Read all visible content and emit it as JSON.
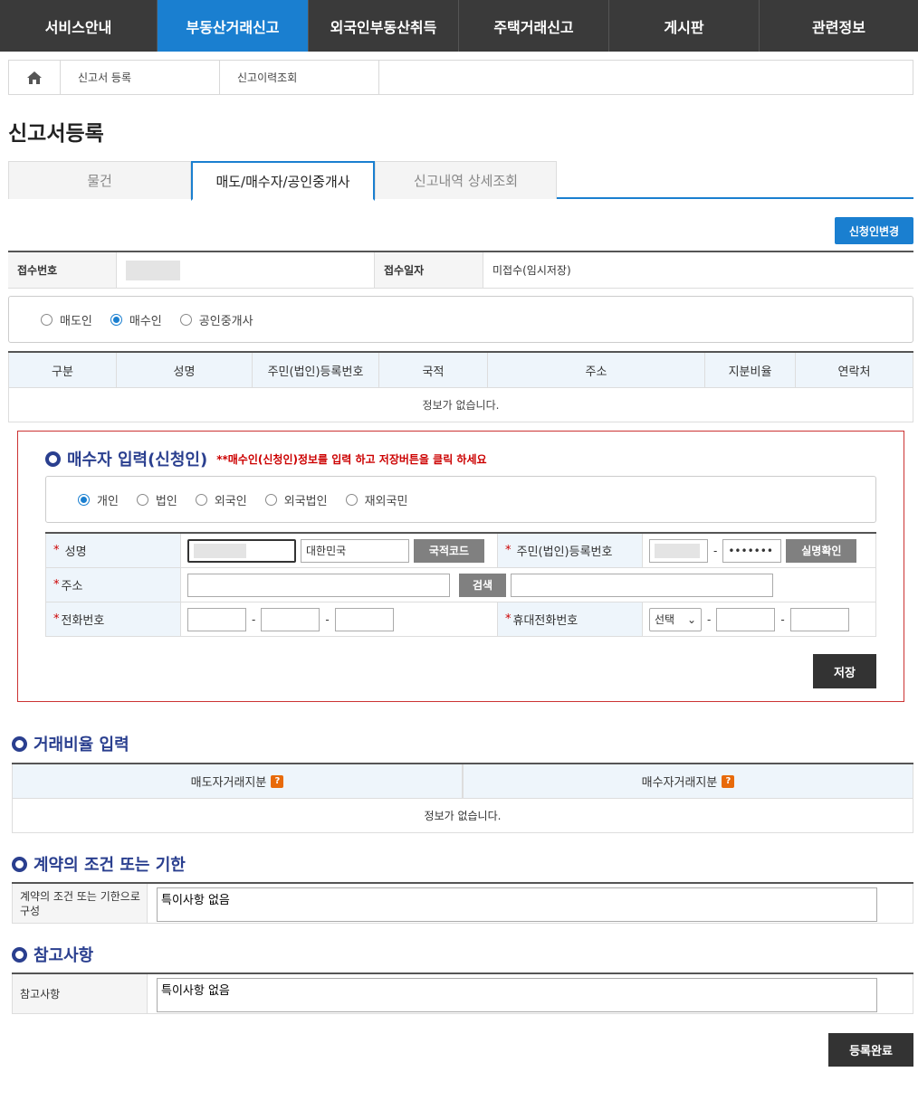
{
  "nav": {
    "items": [
      {
        "label": "서비스안내",
        "active": false
      },
      {
        "label": "부동산거래신고",
        "active": true
      },
      {
        "label": "외국인부동산취득",
        "active": false
      },
      {
        "label": "주택거래신고",
        "active": false
      },
      {
        "label": "게시판",
        "active": false
      },
      {
        "label": "관련정보",
        "active": false
      }
    ]
  },
  "breadcrumb": {
    "home_icon": "home-icon",
    "items": [
      "신고서 등록",
      "신고이력조회"
    ]
  },
  "page_title": "신고서등록",
  "tabs": [
    {
      "label": "물건",
      "active": false
    },
    {
      "label": "매도/매수자/공인중개사",
      "active": true
    },
    {
      "label": "신고내역 상세조회",
      "active": false
    }
  ],
  "change_applicant_label": "신청인변경",
  "receipt": {
    "number_label": "접수번호",
    "number_value": "",
    "date_label": "접수일자",
    "date_value": "미접수(임시저장)"
  },
  "roles": {
    "options": [
      "매도인",
      "매수인",
      "공인중개사"
    ],
    "selected": "매수인"
  },
  "party_table": {
    "headers": [
      "구분",
      "성명",
      "주민(법인)등록번호",
      "국적",
      "주소",
      "지분비율",
      "연락처"
    ],
    "empty_text": "정보가 없습니다."
  },
  "buyer": {
    "title": "매수자 입력(신청인)",
    "hint": "**매수인(신청인)정보를 입력 하고 저장버튼을 클릭 하세요",
    "person_types": [
      "개인",
      "법인",
      "외국인",
      "외국법인",
      "재외국민"
    ],
    "person_selected": "개인",
    "fields": {
      "name_label": "성명",
      "nationality_value": "대한민국",
      "nationality_btn": "국적코드",
      "rrn_label": "주민(법인)등록번호",
      "rrn_back": "•••••••",
      "verify_btn": "실명확인",
      "address_label": "주소",
      "search_btn": "검색",
      "phone_label": "전화번호",
      "mobile_label": "휴대전화번호",
      "mobile_select": "선택",
      "dash": "-"
    },
    "save_label": "저장"
  },
  "ratio": {
    "title": "거래비율 입력",
    "seller_header": "매도자거래지분",
    "buyer_header": "매수자거래지분",
    "help_icon": "?",
    "empty_text": "정보가 없습니다."
  },
  "terms": {
    "title": "계약의 조건 또는 기한",
    "label": "계약의 조건 또는 기한으로 구성",
    "value": "특이사항 없음"
  },
  "notes": {
    "title": "참고사항",
    "label": "참고사항",
    "value": "특이사항 없음"
  },
  "submit_label": "등록완료",
  "colors": {
    "nav_bg": "#3a3a3a",
    "accent": "#1a7fd0",
    "section_title": "#2a3f8f",
    "required": "#cc0000"
  }
}
